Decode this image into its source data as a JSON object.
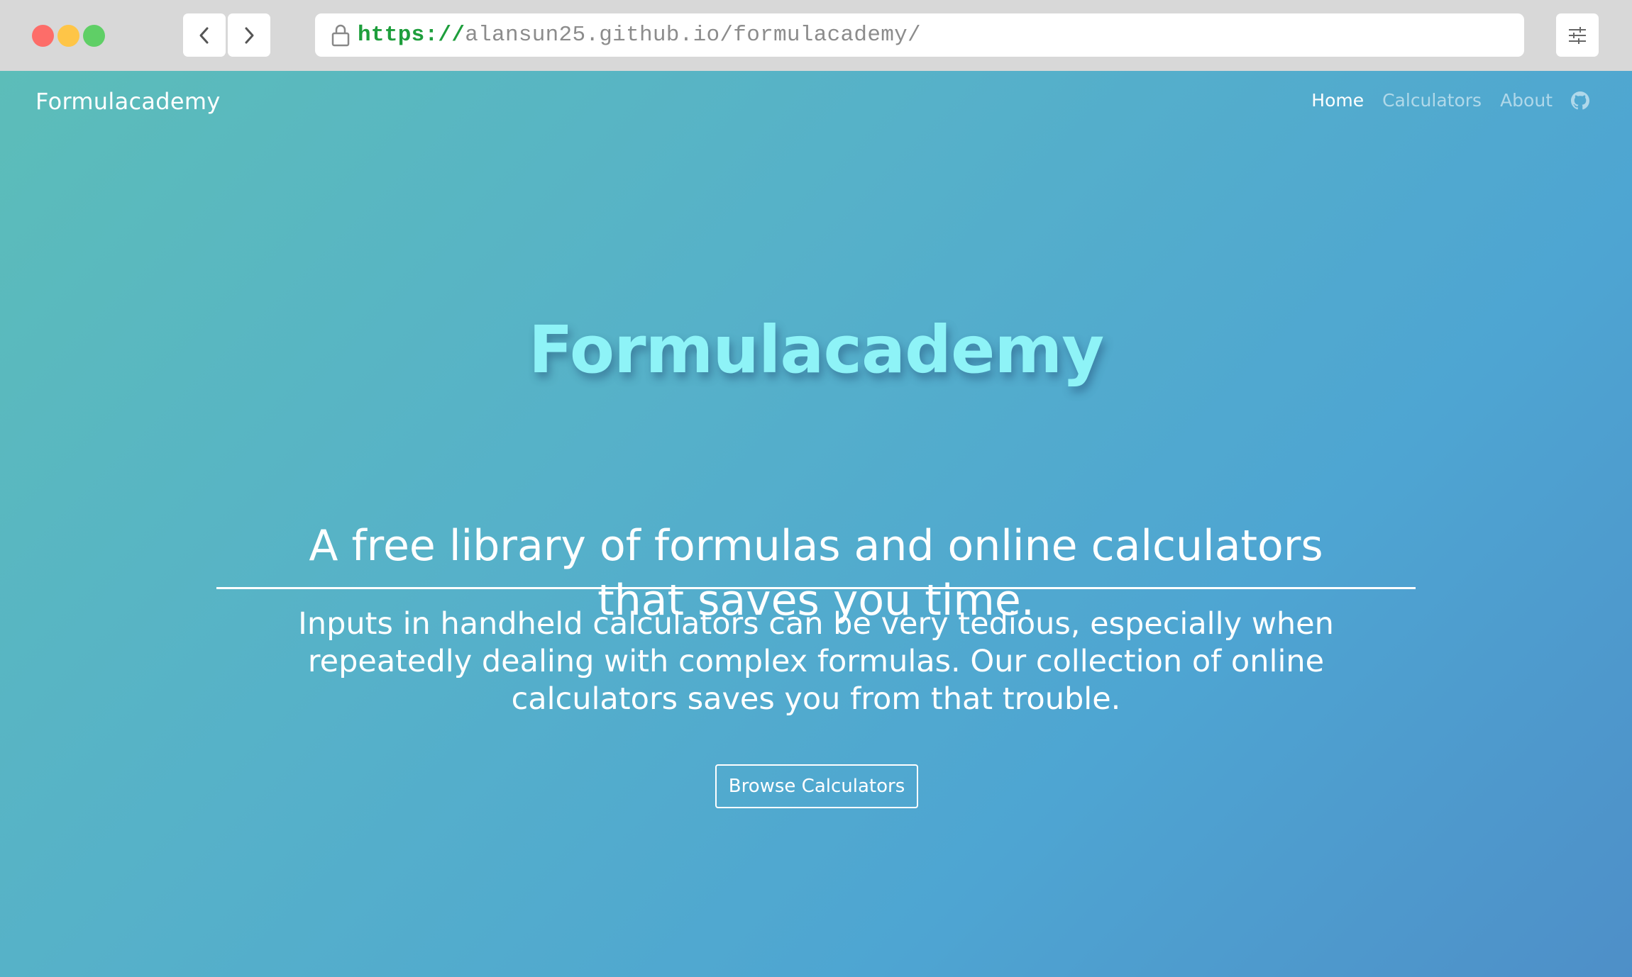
{
  "browser": {
    "url_scheme": "https://",
    "url_rest": "alansun25.github.io/formulacademy/"
  },
  "site_nav": {
    "brand": "Formulacademy",
    "links": [
      {
        "label": "Home",
        "active": true
      },
      {
        "label": "Calculators",
        "active": false
      },
      {
        "label": "About",
        "active": false
      }
    ],
    "github_icon": "github-icon"
  },
  "hero": {
    "title": "Formulacademy",
    "subtitle": "A free library of formulas and online calculators that saves you time.",
    "body": "Inputs in handheld calculators can be very tedious, especially when repeatedly dealing with complex formulas. Our collection of online calculators saves you from that trouble.",
    "button_label": "Browse Calculators"
  },
  "colors": {
    "title": "#8ef3f7",
    "gradient_start": "#5cbdb9",
    "gradient_end": "#4e8fc8",
    "url_scheme": "#1e9e3c"
  }
}
